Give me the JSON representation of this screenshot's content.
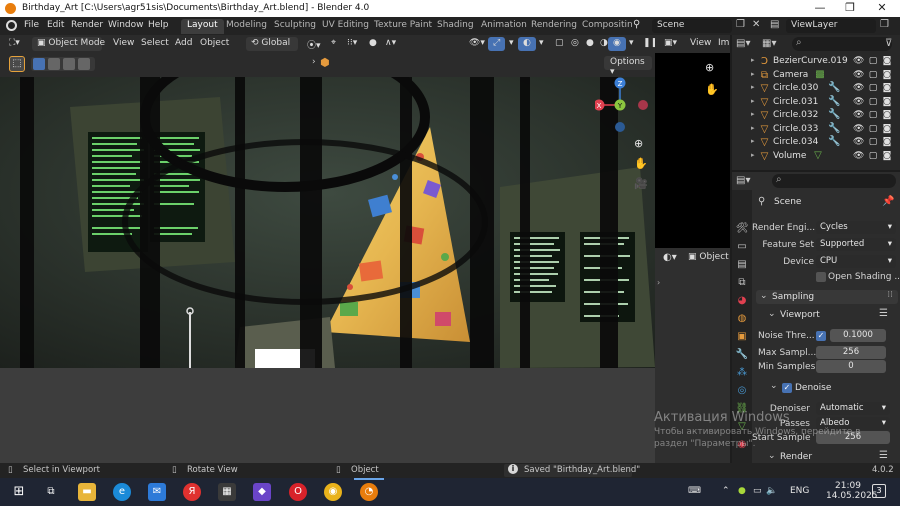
{
  "titlebar": {
    "title": "Birthday_Art [C:\\Users\\agr51sis\\Documents\\Birthday_Art.blend] - Blender 4.0",
    "minimize": "—",
    "maximize": "❐",
    "close": "✕"
  },
  "menu": [
    "File",
    "Edit",
    "Render",
    "Window",
    "Help"
  ],
  "workspaces": [
    "Layout",
    "Modeling",
    "Sculpting",
    "UV Editing",
    "Texture Paint",
    "Shading",
    "Animation",
    "Rendering",
    "Compositin"
  ],
  "scene_selector": {
    "label": "Scene"
  },
  "viewlayer_selector": {
    "label": "ViewLayer"
  },
  "viewport_header": {
    "mode": "Object Mode",
    "menus": [
      "View",
      "Select",
      "Add",
      "Object"
    ],
    "orientation": "Global",
    "options": "Options"
  },
  "mini_header": {
    "object_label": "Object",
    "view": "View",
    "im": "Im"
  },
  "outliner": {
    "items": [
      {
        "name": "BezierCurve.019",
        "icon": "curve-icon"
      },
      {
        "name": "Camera",
        "icon": "camera-icon"
      },
      {
        "name": "Circle.030",
        "icon": "mesh-icon"
      },
      {
        "name": "Circle.031",
        "icon": "mesh-icon"
      },
      {
        "name": "Circle.032",
        "icon": "mesh-icon"
      },
      {
        "name": "Circle.033",
        "icon": "mesh-icon"
      },
      {
        "name": "Circle.034",
        "icon": "mesh-icon"
      },
      {
        "name": "Volume",
        "icon": "mesh-icon"
      }
    ]
  },
  "properties": {
    "context": "Scene",
    "render_engine_label": "Render Engi...",
    "render_engine": "Cycles",
    "feature_set_label": "Feature Set",
    "feature_set": "Supported",
    "device_label": "Device",
    "device": "CPU",
    "open_shading": "Open Shading ...",
    "sampling": "Sampling",
    "viewport": "Viewport",
    "noise_threshold_label": "Noise Thre...",
    "noise_threshold": "0.1000",
    "max_samples_label": "Max Sampl...",
    "max_samples": "256",
    "min_samples_label": "Min Samples",
    "min_samples": "0",
    "denoise": "Denoise",
    "denoiser_label": "Denoiser",
    "denoiser": "Automatic",
    "passes_label": "Passes",
    "passes": "Albedo",
    "start_sample_label": "Start Sample",
    "start_sample": "256",
    "render": "Render"
  },
  "watermark": {
    "line1": "Активация Windows",
    "line2": "Чтобы активировать Windows, перейдите в",
    "line3": "раздел \"Параметры\"."
  },
  "statusbar": {
    "select": "Select in Viewport",
    "rotate": "Rotate View",
    "object": "Object",
    "saved": "Saved \"Birthday_Art.blend\"",
    "version": "4.0.2"
  },
  "taskbar": {
    "lang": "ENG",
    "time": "21:09",
    "date": "14.05.2025",
    "notifications": "3"
  },
  "colors": {
    "accent": "#4772b3",
    "axis_x": "#e04050",
    "axis_y": "#8bc63f",
    "axis_z": "#3c7fd6"
  }
}
